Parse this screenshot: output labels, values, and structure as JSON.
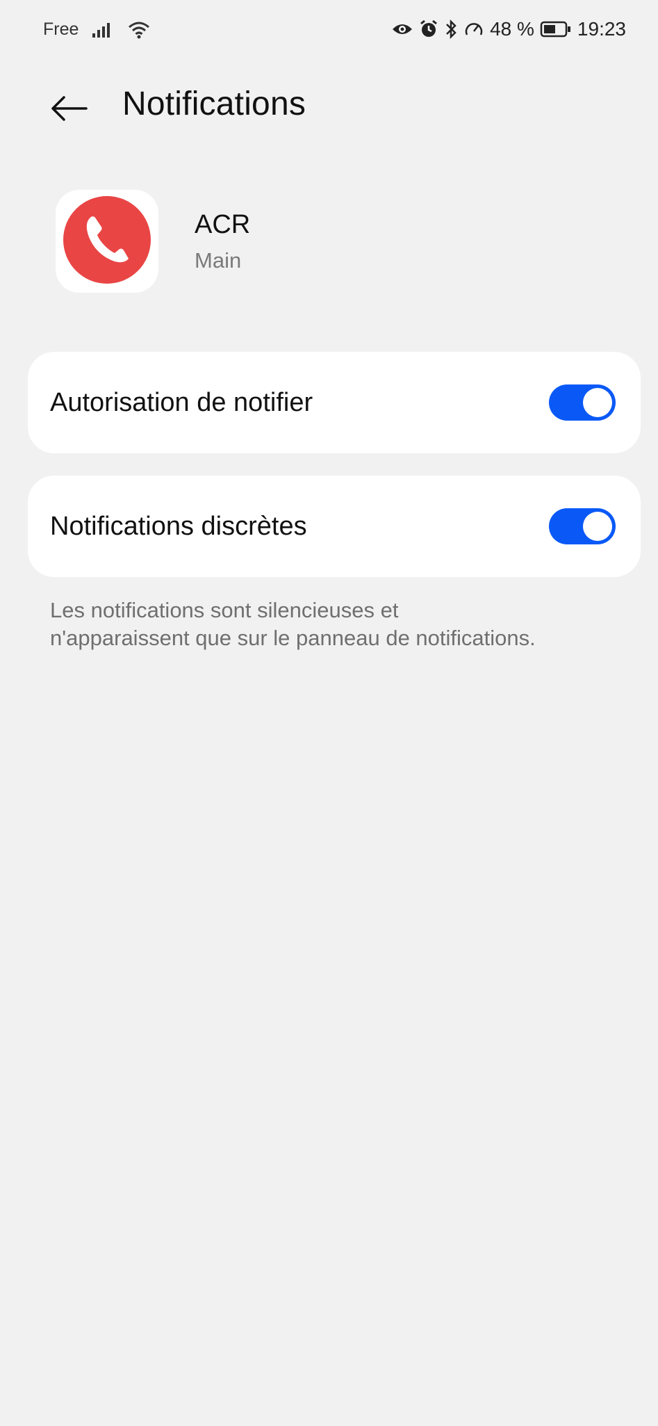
{
  "status_bar": {
    "carrier": "Free",
    "battery_percent": "48 %",
    "time": "19:23",
    "icons": [
      "signal-icon",
      "wifi-icon",
      "eye-icon",
      "alarm-icon",
      "bluetooth-icon",
      "speed-icon",
      "battery-icon"
    ]
  },
  "header": {
    "title": "Notifications",
    "back_icon": "back-arrow-icon"
  },
  "app": {
    "name": "ACR",
    "subtitle": "Main",
    "icon": "phone-call-icon",
    "icon_color": "#e94545"
  },
  "settings": [
    {
      "label": "Autorisation de notifier",
      "enabled": true
    },
    {
      "label": "Notifications discrètes",
      "enabled": true
    }
  ],
  "hint": "Les notifications sont silencieuses et n'apparaissent que sur le panneau de notifications.",
  "colors": {
    "accent": "#0a59f7",
    "background": "#f1f1f1",
    "card": "#ffffff"
  }
}
